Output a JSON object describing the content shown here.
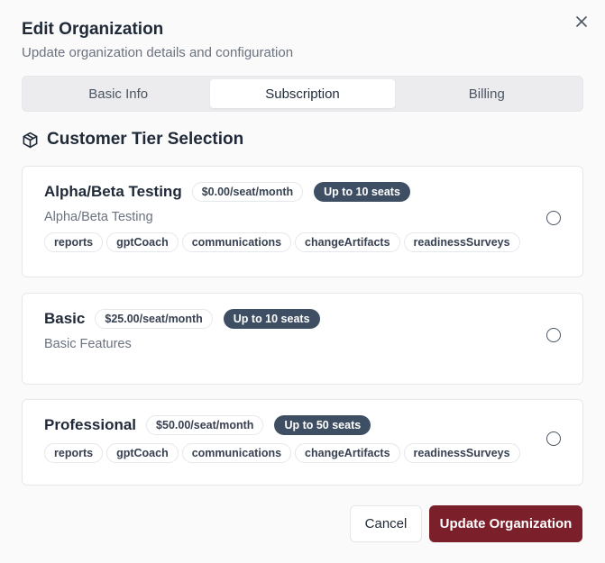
{
  "dialog": {
    "title": "Edit Organization",
    "subtitle": "Update organization details and configuration",
    "close_icon": "close-icon"
  },
  "tabs": [
    {
      "label": "Basic Info",
      "active": false
    },
    {
      "label": "Subscription",
      "active": true
    },
    {
      "label": "Billing",
      "active": false
    }
  ],
  "section": {
    "icon": "package-icon",
    "heading": "Customer Tier Selection"
  },
  "tiers": [
    {
      "name": "Alpha/Beta Testing",
      "price": "$0.00/seat/month",
      "seats": "Up to 10 seats",
      "description": "Alpha/Beta Testing",
      "features": [
        "reports",
        "gptCoach",
        "communications",
        "changeArtifacts",
        "readinessSurveys"
      ],
      "selected": false
    },
    {
      "name": "Basic",
      "price": "$25.00/seat/month",
      "seats": "Up to 10 seats",
      "description": "Basic Features",
      "features": [],
      "selected": false
    },
    {
      "name": "Professional",
      "price": "$50.00/seat/month",
      "seats": "Up to 50 seats",
      "features": [
        "reports",
        "gptCoach",
        "communications",
        "changeArtifacts",
        "readinessSurveys"
      ],
      "selected": false
    }
  ],
  "footer": {
    "cancel_label": "Cancel",
    "submit_label": "Update Organization"
  },
  "colors": {
    "primary": "#7b1f2a",
    "seats_badge": "#3f4f63",
    "background": "#fafafa"
  }
}
